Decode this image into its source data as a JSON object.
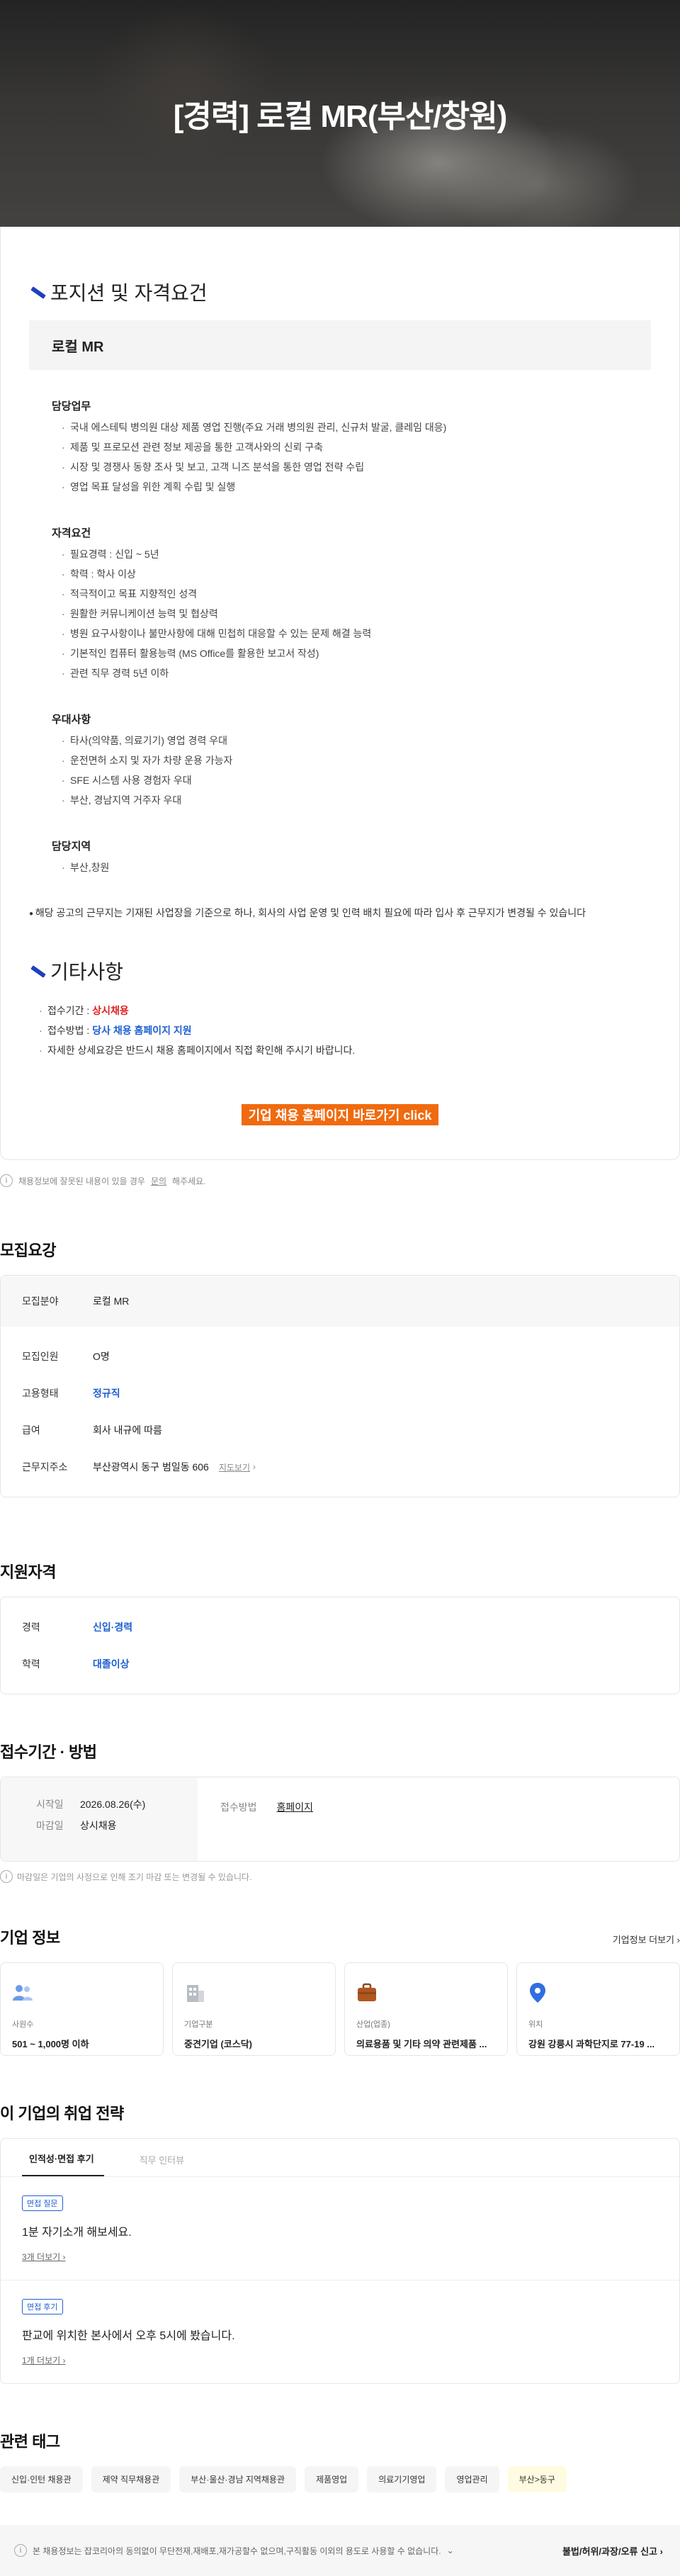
{
  "hero": {
    "title": "[경력] 로컬 MR(부산/창원)"
  },
  "description": {
    "section1_title": "포지션 및 자격요건",
    "position_name": "로컬 MR",
    "groups": [
      {
        "title": "담당업무",
        "items": [
          "국내 에스테틱 병의원 대상 제품 영업 진행(주요 거래 병의원 관리, 신규처 발굴, 클레임 대응)",
          "제품 및 프로모션 관련 정보 제공을 통한 고객사와의 신뢰 구축",
          "시장 및 경쟁사 동향 조사 및 보고, 고객 니즈 분석을 통한 영업 전략 수립",
          "영업 목표 달성을 위한 계획 수립 및 실행"
        ]
      },
      {
        "title": "자격요건",
        "items": [
          "필요경력 : 신입 ~ 5년",
          "학력 : 학사 이상",
          "적극적이고 목표 지향적인 성격",
          "원활한 커뮤니케이션 능력 및 협상력",
          "병원 요구사항이나 불만사항에 대해 민첩히 대응할 수 있는 문제 해결 능력",
          "기본적인 컴퓨터 활용능력 (MS Office를 활용한 보고서 작성)",
          "관련 직무 경력 5년 이하"
        ]
      },
      {
        "title": "우대사항",
        "items": [
          "타사(의약품, 의료기기) 영업 경력 우대",
          "운전면허 소지 및 자가 차량 운용 가능자",
          "SFE 시스템 사용 경험자 우대",
          "부산, 경남지역 거주자 우대"
        ]
      },
      {
        "title": "담당지역",
        "items": [
          "부산,창원"
        ]
      }
    ],
    "note": "해당 공고의 근무지는 기재된 사업장을 기준으로 하나, 회사의 사업 운영 및 인력 배치 필요에 따라 입사 후 근무지가 변경될 수 있습니다",
    "section2_title": "기타사항",
    "etc": {
      "period_label": "접수기간 : ",
      "period_value": "상시채용",
      "method_label": "접수방법 : ",
      "method_value": "당사 채용 홈페이지 지원",
      "detail": "자세한 상세요강은 반드시 채용 홈페이지에서 직접 확인해 주시기 바랍니다."
    },
    "cta_label": "기업 채용 홈페이지 바로가기 click"
  },
  "report": {
    "prefix": "채용정보에 잘못된 내용이 있을 경우 ",
    "link": "문의",
    "suffix": "해주세요."
  },
  "recruit": {
    "title": "모집요강",
    "rows": [
      {
        "k": "모집분야",
        "v": "로컬 MR"
      },
      {
        "k": "모집인원",
        "v": "O명"
      },
      {
        "k": "고용형태",
        "v": "정규직"
      },
      {
        "k": "급여",
        "v": "회사 내규에 따름"
      },
      {
        "k": "근무지주소",
        "v": "부산광역시 동구 범일동 606"
      }
    ],
    "map_link": "지도보기"
  },
  "qualification": {
    "title": "지원자격",
    "rows": [
      {
        "k": "경력",
        "v": "신입·경력"
      },
      {
        "k": "학력",
        "v": "대졸이상"
      }
    ]
  },
  "period": {
    "title": "접수기간 · 방법",
    "start_label": "시작일",
    "start_value": "2026.08.26(수)",
    "end_label": "마감일",
    "end_value": "상시채용",
    "method_label": "접수방법",
    "method_value": "홈페이지",
    "note": "마감일은 기업의 사정으로 인해 조기 마감 또는 변경될 수 있습니다."
  },
  "company": {
    "title": "기업 정보",
    "more": "기업정보 더보기",
    "cards": [
      {
        "label": "사원수",
        "value": "501 ~ 1,000명 이하",
        "icon": "people-icon"
      },
      {
        "label": "기업구분",
        "value": "중견기업 (코스닥)",
        "icon": "building-icon"
      },
      {
        "label": "산업(업종)",
        "value": "의료용품 및 기타 의약 관련제품 ...",
        "icon": "briefcase-icon"
      },
      {
        "label": "위치",
        "value": "강원 강릉시 과학단지로 77-19 ...",
        "icon": "location-pin-icon"
      }
    ]
  },
  "strategy": {
    "title": "이 기업의 취업 전략",
    "tabs": [
      "인적성·면접 후기",
      "직무 인터뷰"
    ],
    "items": [
      {
        "badge": "면접 질문",
        "text": "1분 자기소개 해보세요.",
        "more": "3개 더보기"
      },
      {
        "badge": "면접 후기",
        "text": "판교에 위치한 본사에서 오후 5시에 봤습니다.",
        "more": "1개 더보기"
      }
    ]
  },
  "tags": {
    "title": "관련 태그",
    "items": [
      "신입·인턴 채용관",
      "제약 직무채용관",
      "부산·울산·경남 지역채용관",
      "제품영업",
      "의료기기영업",
      "영업관리",
      "부산>동구"
    ]
  },
  "footer": {
    "text": "본 채용정보는 잡코리아의 동의없이 무단전재,재배포,재가공할수 없으며,구직활동 이외의 용도로 사용할 수 없습니다.",
    "right": "불법/허위/과장/오류 신고"
  }
}
